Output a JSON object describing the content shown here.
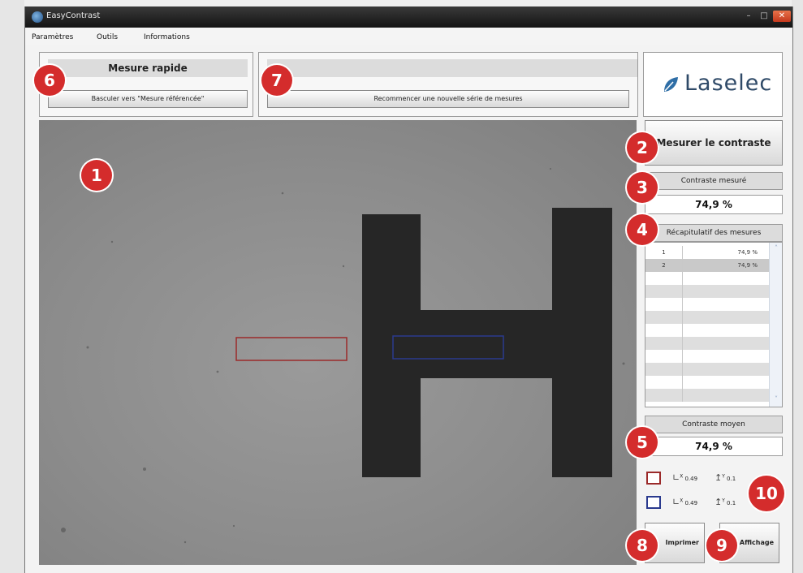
{
  "window": {
    "title": "EasyContrast",
    "min_symbol": "–",
    "max_symbol": "□",
    "close_symbol": "✕"
  },
  "menu": [
    "Paramètres",
    "Outils",
    "Informations"
  ],
  "mode_panel": {
    "title": "Mesure rapide",
    "switch_button": "Basculer vers \"Mesure référencée\""
  },
  "series_panel": {
    "restart_button": "Recommencer une nouvelle série de mesures"
  },
  "logo": {
    "text": "Laselec"
  },
  "measure_button": "Mesurer le contraste",
  "measured": {
    "header": "Contraste mesuré",
    "value": "74,9 %"
  },
  "summary": {
    "header": "Récapitulatif des mesures",
    "rows": [
      {
        "index": "1",
        "value": "74,9 %"
      },
      {
        "index": "2",
        "value": "74,9 %"
      }
    ],
    "scroll_up": "˄",
    "scroll_down": "˅"
  },
  "average": {
    "header": "Contraste moyen",
    "value": "74,9 %"
  },
  "roi": [
    {
      "color": "#9b2a2a",
      "x_label": "X",
      "x_value": "0.49",
      "y_label": "Y",
      "y_value": "0.1"
    },
    {
      "color": "#2a3a8e",
      "x_label": "X",
      "x_value": "0.49",
      "y_label": "Y",
      "y_value": "0.1"
    }
  ],
  "print_button": "Imprimer",
  "display_button": "Affichage",
  "badges": [
    "1",
    "2",
    "3",
    "4",
    "5",
    "6",
    "7",
    "8",
    "9",
    "10"
  ],
  "colors": {
    "badge": "#d42c2c",
    "roi_red": "#9b2a2a",
    "roi_blue": "#2a3a8e",
    "logo": "#2f4a68",
    "logo_leaf": "#2f6ea6"
  }
}
